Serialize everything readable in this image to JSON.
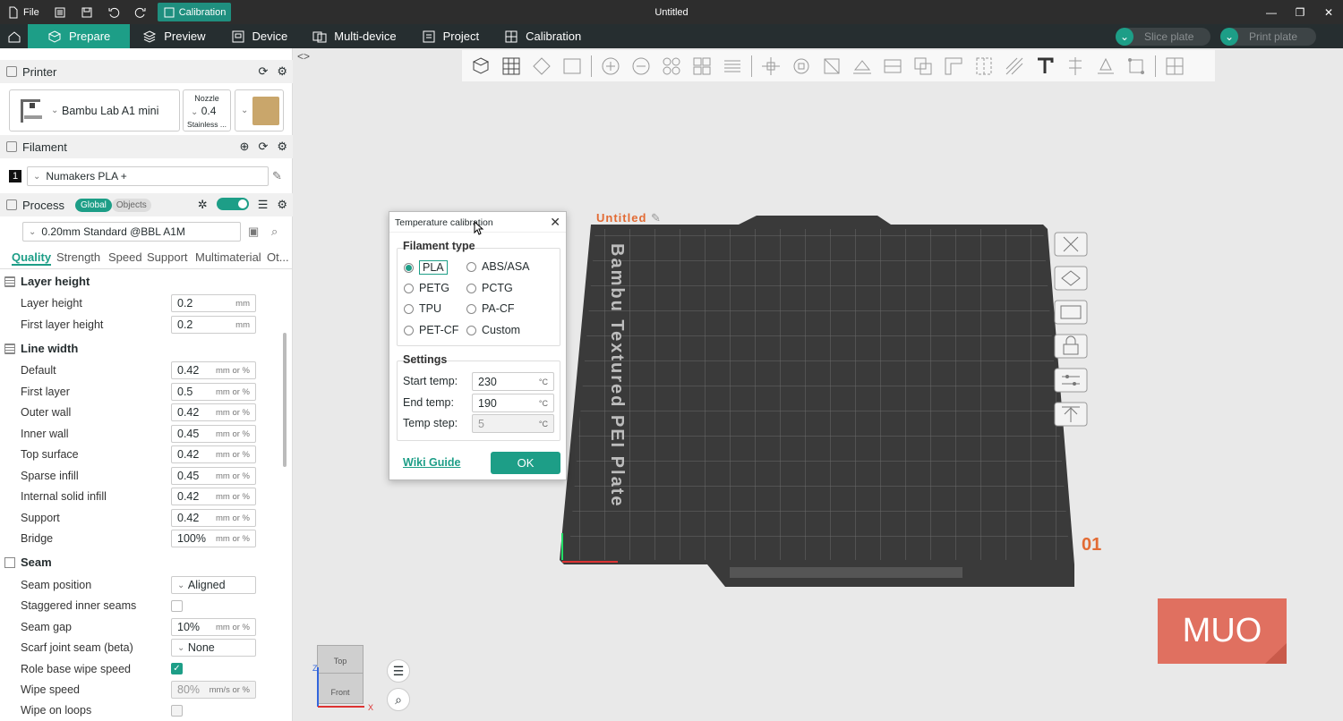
{
  "app": {
    "title": "Untitled",
    "file_label": "File",
    "calibration_badge": "Calibration"
  },
  "tabs": [
    {
      "label": "Prepare"
    },
    {
      "label": "Preview"
    },
    {
      "label": "Device"
    },
    {
      "label": "Multi-device"
    },
    {
      "label": "Project"
    },
    {
      "label": "Calibration"
    }
  ],
  "actions": {
    "slice": "Slice plate",
    "print": "Print plate"
  },
  "printer": {
    "header": "Printer",
    "name": "Bambu Lab A1 mini",
    "nozzle_label": "Nozzle",
    "nozzle_value": "0.4",
    "nozzle_type": "Stainless ..."
  },
  "filament": {
    "header": "Filament",
    "index": "1",
    "name": "Numakers PLA +"
  },
  "process": {
    "header": "Process",
    "global": "Global",
    "objects": "Objects",
    "preset": "0.20mm Standard @BBL A1M",
    "tabs": [
      "Quality",
      "Strength",
      "Speed",
      "Support",
      "Multimaterial",
      "Ot..."
    ]
  },
  "groups": {
    "layer_height": "Layer height",
    "line_width": "Line width",
    "seam": "Seam"
  },
  "settings": {
    "layer_height": {
      "label": "Layer height",
      "value": "0.2",
      "unit": "mm"
    },
    "first_layer_height": {
      "label": "First layer height",
      "value": "0.2",
      "unit": "mm"
    },
    "default": {
      "label": "Default",
      "value": "0.42",
      "unit": "mm or %"
    },
    "first_layer": {
      "label": "First layer",
      "value": "0.5",
      "unit": "mm or %"
    },
    "outer_wall": {
      "label": "Outer wall",
      "value": "0.42",
      "unit": "mm or %"
    },
    "inner_wall": {
      "label": "Inner wall",
      "value": "0.45",
      "unit": "mm or %"
    },
    "top_surface": {
      "label": "Top surface",
      "value": "0.42",
      "unit": "mm or %"
    },
    "sparse_infill": {
      "label": "Sparse infill",
      "value": "0.45",
      "unit": "mm or %"
    },
    "internal_solid_infill": {
      "label": "Internal solid infill",
      "value": "0.42",
      "unit": "mm or %"
    },
    "support": {
      "label": "Support",
      "value": "0.42",
      "unit": "mm or %"
    },
    "bridge": {
      "label": "Bridge",
      "value": "100%",
      "unit": "mm or %"
    },
    "seam_position": {
      "label": "Seam position",
      "value": "Aligned"
    },
    "staggered": {
      "label": "Staggered inner seams"
    },
    "seam_gap": {
      "label": "Seam gap",
      "value": "10%",
      "unit": "mm or %"
    },
    "scarf": {
      "label": "Scarf joint seam (beta)",
      "value": "None"
    },
    "role_wipe": {
      "label": "Role base wipe speed"
    },
    "wipe_speed": {
      "label": "Wipe speed",
      "value": "80%",
      "unit": "mm/s or %"
    },
    "wipe_loops": {
      "label": "Wipe on loops"
    }
  },
  "plate": {
    "name": "Untitled",
    "number": "01",
    "text": "Bambu Textured PEI Plate"
  },
  "dialog": {
    "title": "Temperature calibration",
    "filament_type": "Filament type",
    "types": [
      "PLA",
      "ABS/ASA",
      "PETG",
      "PCTG",
      "TPU",
      "PA-CF",
      "PET-CF",
      "Custom"
    ],
    "settings_title": "Settings",
    "start_label": "Start temp:",
    "start_value": "230",
    "end_label": "End temp:",
    "end_value": "190",
    "step_label": "Temp step:",
    "step_value": "5",
    "unit": "°C",
    "wiki": "Wiki Guide",
    "ok": "OK"
  },
  "viewcube": {
    "top": "Top",
    "front": "Front"
  },
  "watermark": "MUO"
}
